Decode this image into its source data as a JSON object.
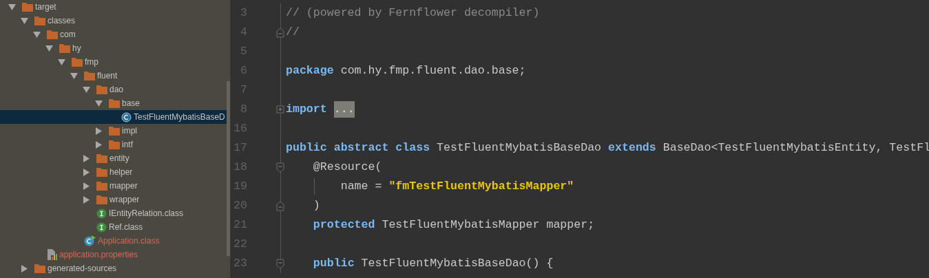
{
  "project_tree": [
    {
      "name": "target",
      "kind": "folder",
      "expanded": true,
      "selected": false,
      "unversioned": false,
      "children": [
        {
          "name": "classes",
          "kind": "folder",
          "expanded": true,
          "selected": false,
          "unversioned": false,
          "children": [
            {
              "name": "com",
              "kind": "folder",
              "expanded": true,
              "selected": false,
              "unversioned": false,
              "children": [
                {
                  "name": "hy",
                  "kind": "folder",
                  "expanded": true,
                  "selected": false,
                  "unversioned": false,
                  "children": [
                    {
                      "name": "fmp",
                      "kind": "folder",
                      "expanded": true,
                      "selected": false,
                      "unversioned": false,
                      "children": [
                        {
                          "name": "fluent",
                          "kind": "folder",
                          "expanded": true,
                          "selected": false,
                          "unversioned": false,
                          "children": [
                            {
                              "name": "dao",
                              "kind": "folder",
                              "expanded": true,
                              "selected": false,
                              "unversioned": false,
                              "children": [
                                {
                                  "name": "base",
                                  "kind": "folder",
                                  "expanded": true,
                                  "selected": false,
                                  "unversioned": false,
                                  "children": [
                                    {
                                      "name": "TestFluentMybatisBaseD",
                                      "kind": "class",
                                      "selected": true,
                                      "unversioned": false
                                    }
                                  ]
                                },
                                {
                                  "name": "impl",
                                  "kind": "folder",
                                  "expanded": false,
                                  "selected": false,
                                  "unversioned": false
                                },
                                {
                                  "name": "intf",
                                  "kind": "folder",
                                  "expanded": false,
                                  "selected": false,
                                  "unversioned": false
                                }
                              ]
                            },
                            {
                              "name": "entity",
                              "kind": "folder",
                              "expanded": false,
                              "selected": false,
                              "unversioned": false
                            },
                            {
                              "name": "helper",
                              "kind": "folder",
                              "expanded": false,
                              "selected": false,
                              "unversioned": false
                            },
                            {
                              "name": "mapper",
                              "kind": "folder",
                              "expanded": false,
                              "selected": false,
                              "unversioned": false
                            },
                            {
                              "name": "wrapper",
                              "kind": "folder",
                              "expanded": false,
                              "selected": false,
                              "unversioned": false
                            },
                            {
                              "name": "IEntityRelation.class",
                              "kind": "interface",
                              "selected": false,
                              "unversioned": false
                            },
                            {
                              "name": "Ref.class",
                              "kind": "interface",
                              "selected": false,
                              "unversioned": false
                            }
                          ]
                        },
                        {
                          "name": "Application.class",
                          "kind": "main-class",
                          "selected": false,
                          "unversioned": true
                        }
                      ]
                    }
                  ]
                }
              ]
            },
            {
              "name": "application.properties",
              "kind": "properties",
              "selected": false,
              "unversioned": true
            }
          ]
        },
        {
          "name": "generated-sources",
          "kind": "folder",
          "expanded": false,
          "selected": false,
          "unversioned": false
        }
      ]
    }
  ],
  "editor": {
    "lines": [
      {
        "number": "3",
        "kind": "plain",
        "indent_guide": false,
        "tokens": [
          {
            "kind": "comment",
            "text": "// (powered by Fernflower decompiler)"
          }
        ]
      },
      {
        "number": "4",
        "kind": "fold-end",
        "indent_guide": false,
        "tokens": [
          {
            "kind": "comment",
            "text": "//"
          }
        ]
      },
      {
        "number": "5",
        "kind": "plain",
        "indent_guide": false
      },
      {
        "number": "6",
        "kind": "plain",
        "indent_guide": false,
        "tokens": [
          {
            "kind": "keyword",
            "text": "package "
          },
          {
            "kind": "plain",
            "text": "com.hy.fmp.fluent.dao.base;"
          }
        ]
      },
      {
        "number": "7",
        "kind": "plain",
        "indent_guide": false
      },
      {
        "number": "8",
        "kind": "fold-collapsed",
        "indent_guide": false,
        "tokens": [
          {
            "kind": "keyword",
            "text": "import "
          },
          {
            "kind": "folded",
            "text": "..."
          }
        ]
      },
      {
        "number": "16",
        "kind": "plain",
        "indent_guide": false
      },
      {
        "number": "17",
        "kind": "plain",
        "indent_guide": false,
        "tokens": [
          {
            "kind": "keyword",
            "text": "public abstract class"
          },
          {
            "kind": "plain",
            "text": " TestFluentMybatisBaseDao "
          },
          {
            "kind": "keyword",
            "text": "extends"
          },
          {
            "kind": "plain",
            "text": " BaseDao<TestFluentMybatisEntity, TestFl"
          }
        ]
      },
      {
        "number": "18",
        "kind": "fold-start",
        "indent_guide": false,
        "tokens": [
          {
            "kind": "plain",
            "text": "    @Resource("
          }
        ]
      },
      {
        "number": "19",
        "kind": "plain",
        "indent_guide": true,
        "tokens": [
          {
            "kind": "plain",
            "text": "        name = "
          },
          {
            "kind": "string",
            "text": "\"fmTestFluentMybatisMapper\""
          }
        ]
      },
      {
        "number": "20",
        "kind": "fold-end",
        "indent_guide": false,
        "tokens": [
          {
            "kind": "plain",
            "text": "    )"
          }
        ]
      },
      {
        "number": "21",
        "kind": "plain",
        "indent_guide": false,
        "tokens": [
          {
            "kind": "keyword",
            "text": "    protected"
          },
          {
            "kind": "plain",
            "text": " TestFluentMybatisMapper mapper;"
          }
        ]
      },
      {
        "number": "22",
        "kind": "plain",
        "indent_guide": false
      },
      {
        "number": "23",
        "kind": "fold-start",
        "indent_guide": false,
        "tokens": [
          {
            "kind": "keyword",
            "text": "    public"
          },
          {
            "kind": "plain",
            "text": " TestFluentMybatisBaseDao() {"
          }
        ]
      }
    ]
  }
}
